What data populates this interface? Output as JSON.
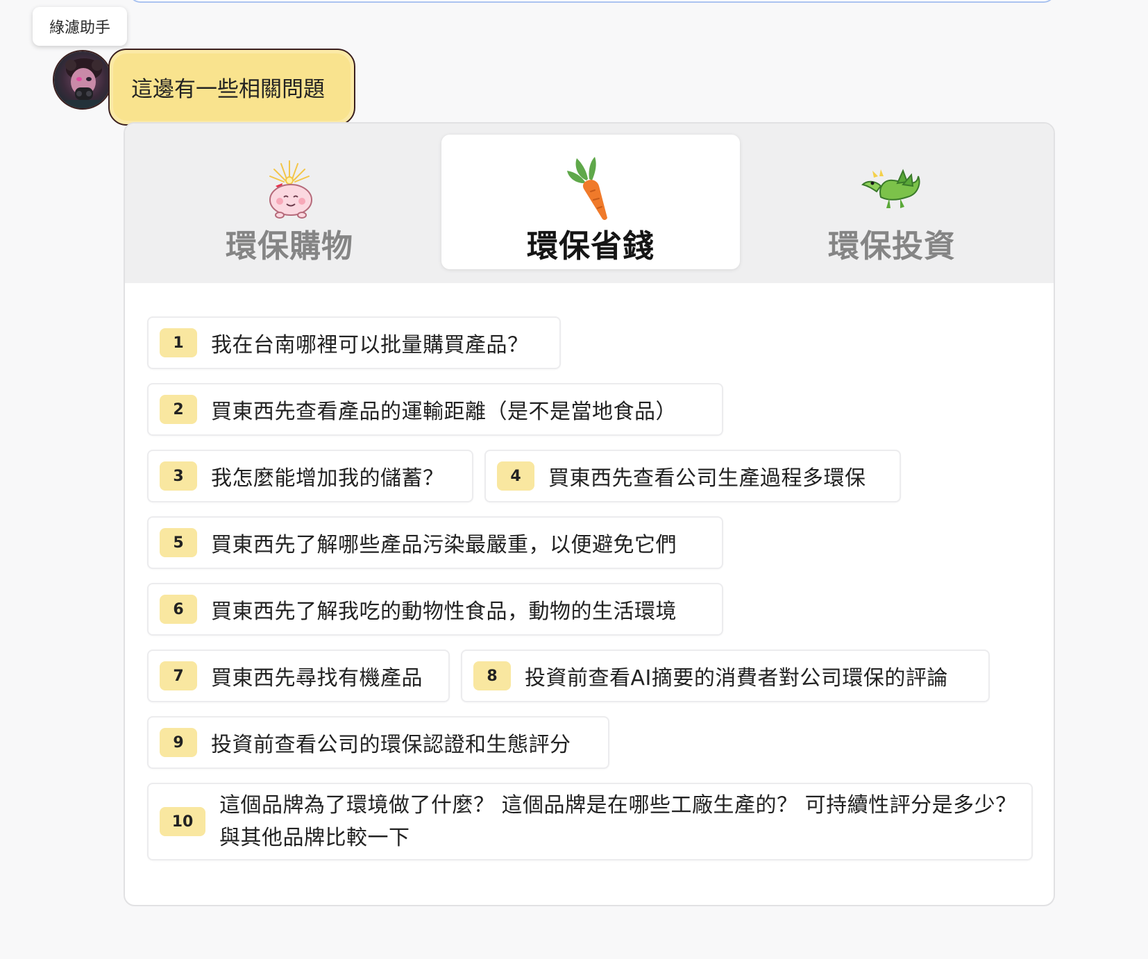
{
  "assistant": {
    "name": "綠濾助手",
    "message": "這邊有一些相關問題"
  },
  "tabs": [
    {
      "label": "環保購物",
      "icon": "sparkling-pig-icon",
      "active": false
    },
    {
      "label": "環保省錢",
      "icon": "carrot-icon",
      "active": true
    },
    {
      "label": "環保投資",
      "icon": "dragon-icon",
      "active": false
    }
  ],
  "questions": [
    {
      "num": "1",
      "text": "我在台南哪裡可以批量購買產品？"
    },
    {
      "num": "2",
      "text": "買東西先查看產品的運輸距離（是不是當地食品）"
    },
    {
      "num": "3",
      "text": "我怎麼能增加我的儲蓄？"
    },
    {
      "num": "4",
      "text": "買東西先查看公司生產過程多環保"
    },
    {
      "num": "5",
      "text": "買東西先了解哪些產品污染最嚴重，以便避免它們"
    },
    {
      "num": "6",
      "text": "買東西先了解我吃的動物性食品，動物的生活環境"
    },
    {
      "num": "7",
      "text": "買東西先尋找有機產品"
    },
    {
      "num": "8",
      "text": "投資前查看AI摘要的消費者對公司環保的評論"
    },
    {
      "num": "9",
      "text": "投資前查看公司的環保認證和生態評分"
    },
    {
      "num": "10",
      "text": "這個品牌為了環境做了什麼？ 這個品牌是在哪些工廠生產的？ 可持續性評分是多少？與其他品牌比較一下"
    }
  ],
  "colors": {
    "accent_yellow": "#f9e38e",
    "number_badge": "#f9e7a0",
    "active_tab_text": "#151515",
    "inactive_tab_text": "#858585"
  }
}
